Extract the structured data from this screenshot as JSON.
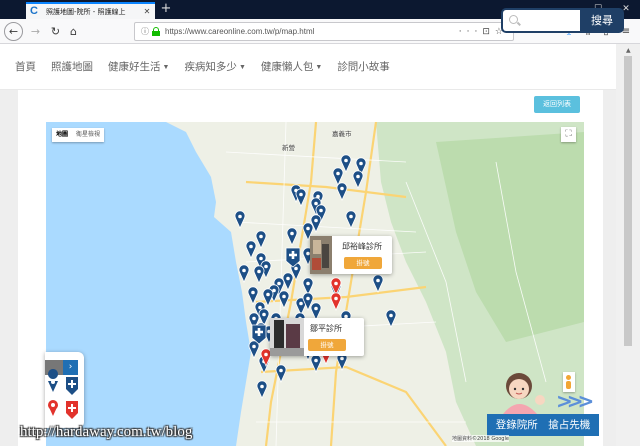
{
  "browser": {
    "tab_title": "照護地圖-院所 - 照護線上",
    "url": "https://www.careonline.com.tw/p/map.html",
    "favicon": "C",
    "accent": "#0a84ff"
  },
  "site": {
    "nav": [
      {
        "label": "首頁",
        "caret": false
      },
      {
        "label": "照護地圖",
        "caret": false
      },
      {
        "label": "健康好生活",
        "caret": true
      },
      {
        "label": "疾病知多少",
        "caret": true
      },
      {
        "label": "健康懶人包",
        "caret": true
      },
      {
        "label": "診問小故事",
        "caret": false
      }
    ],
    "search_button": "搜尋",
    "brand_color": "#1f3f66"
  },
  "page": {
    "back_to_list": "返回列表"
  },
  "map": {
    "type_tabs": [
      "地圖",
      "衛星檢視"
    ],
    "active_type": "地圖",
    "cities": [
      "嘉義市",
      "新營"
    ],
    "credit": "地圖資料©2018 Google",
    "marker_color": "#1d4f86",
    "highlight_color": "#e2332c"
  },
  "clinics": [
    {
      "name": "邱裕峰診所",
      "button": "掛號"
    },
    {
      "name": "鄒平診所",
      "button": "掛號"
    }
  ],
  "promo": {
    "text": "登錄院所　搶占先機",
    "color": "#1f6fb4"
  },
  "watermark": "http://hardaway.com.tw/blog"
}
